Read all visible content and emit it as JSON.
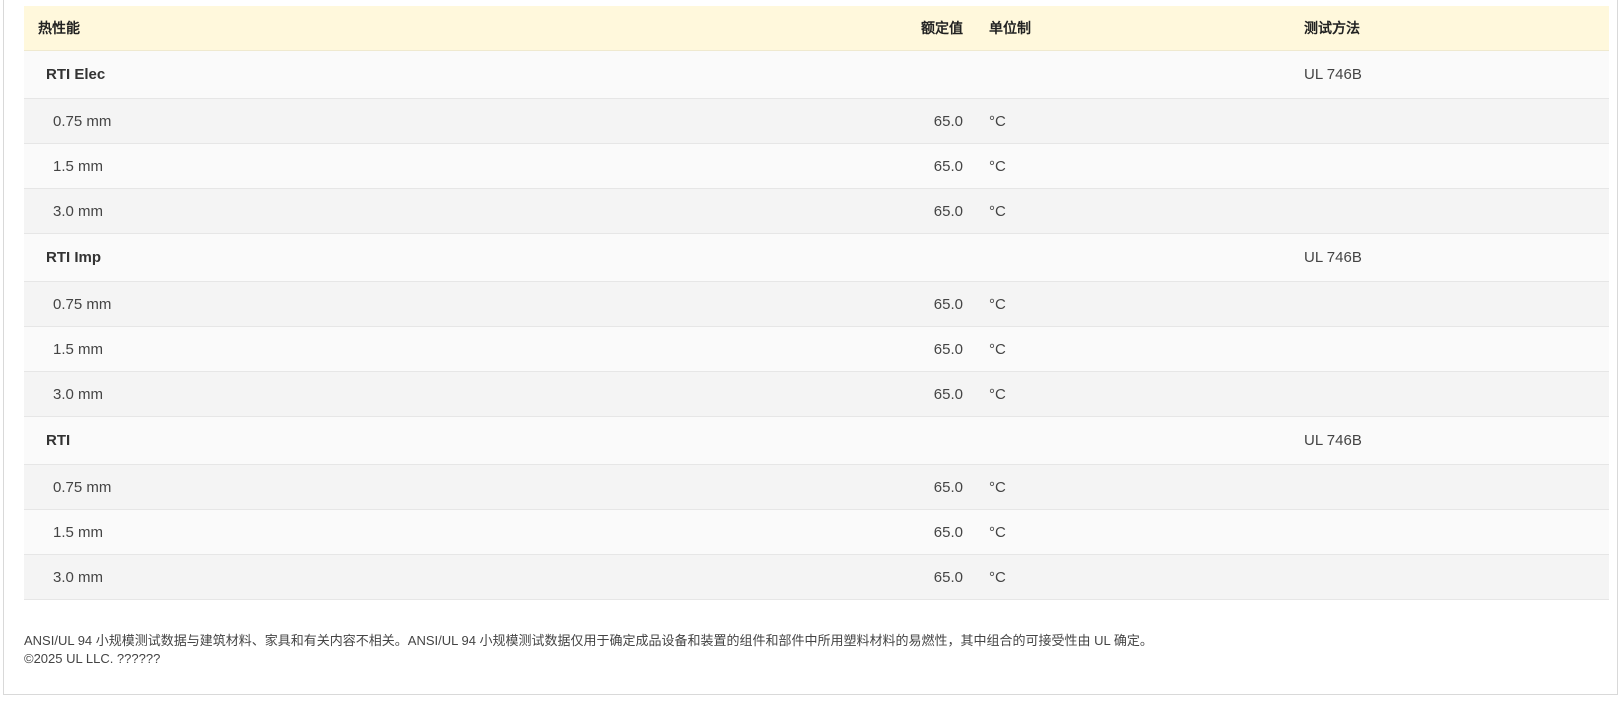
{
  "header": {
    "property": "热性能",
    "rated_value": "额定值",
    "unit": "单位制",
    "test_method": "测试方法"
  },
  "groups": [
    {
      "name": "RTI Elec",
      "test_method": "UL 746B",
      "rows": [
        {
          "thickness": "0.75 mm",
          "value": "65.0",
          "unit": "°C"
        },
        {
          "thickness": "1.5 mm",
          "value": "65.0",
          "unit": "°C"
        },
        {
          "thickness": "3.0 mm",
          "value": "65.0",
          "unit": "°C"
        }
      ]
    },
    {
      "name": "RTI Imp",
      "test_method": "UL 746B",
      "rows": [
        {
          "thickness": "0.75 mm",
          "value": "65.0",
          "unit": "°C"
        },
        {
          "thickness": "1.5 mm",
          "value": "65.0",
          "unit": "°C"
        },
        {
          "thickness": "3.0 mm",
          "value": "65.0",
          "unit": "°C"
        }
      ]
    },
    {
      "name": "RTI",
      "test_method": "UL 746B",
      "rows": [
        {
          "thickness": "0.75 mm",
          "value": "65.0",
          "unit": "°C"
        },
        {
          "thickness": "1.5 mm",
          "value": "65.0",
          "unit": "°C"
        },
        {
          "thickness": "3.0 mm",
          "value": "65.0",
          "unit": "°C"
        }
      ]
    }
  ],
  "footer": {
    "disclaimer": "ANSI/UL 94 小规模测试数据与建筑材料、家具和有关内容不相关。ANSI/UL 94 小规模测试数据仅用于确定成品设备和装置的组件和部件中所用塑料材料的易燃性，其中组合的可接受性由 UL 确定。",
    "copyright": "©2025 UL LLC. ??????"
  },
  "colors": {
    "header_bg": "#fff8dc",
    "row_odd": "#f4f4f4",
    "row_even": "#fafafa"
  }
}
